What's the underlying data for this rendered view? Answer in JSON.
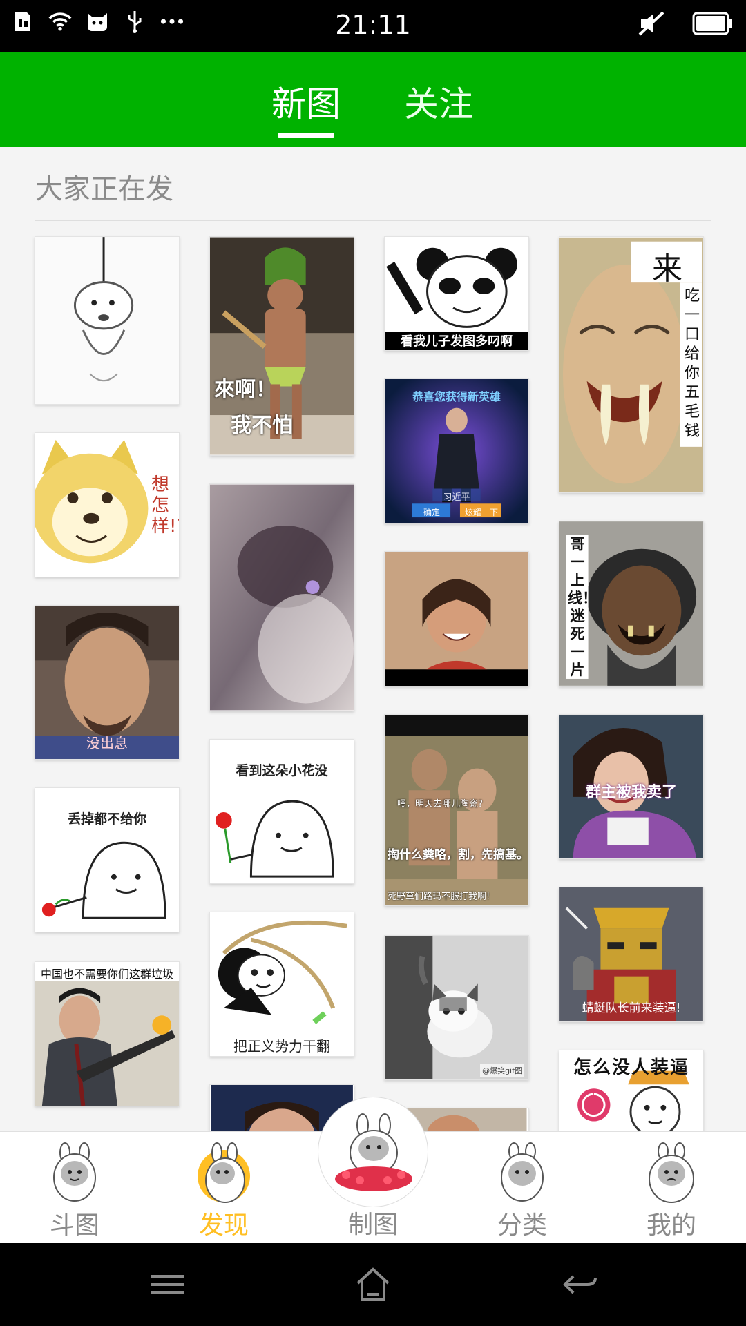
{
  "status_bar": {
    "time": "21:11",
    "icons_left": [
      "sim-card-icon",
      "wifi-icon",
      "cat-notification-icon",
      "usb-icon",
      "more-dots-icon"
    ],
    "icons_right": [
      "mute-icon",
      "battery-icon"
    ]
  },
  "top_tabs": [
    {
      "label": "新图",
      "active": true
    },
    {
      "label": "关注",
      "active": false
    }
  ],
  "section": {
    "title": "大家正在发"
  },
  "feed": {
    "captions": {
      "card2": [
        "來啊！",
        "我不怕"
      ],
      "card3": "看我儿子发图多叼啊",
      "card4_big": "来",
      "card4_side": "吃一口给你五毛钱",
      "card6_header": "恭喜您获得新英雄",
      "card6_name": "习近平",
      "card6_btn1": "确定",
      "card6_btn2": "炫耀一下",
      "card8_side": "哥一上线！迷死一片",
      "card9_tag": "没出息",
      "card12_top": "看到这朵小花没",
      "card13_lines": [
        "嘿，明天去哪儿陶瓷?",
        "掏什么粪咯，割，先搞基。",
        "死野草们路玛不服打我啊!"
      ],
      "card14": "群主被我卖了",
      "card15": "丢掉都不给你",
      "card16": "把正义势力干翻",
      "card18": "蜻蜓队长前来装逼!",
      "card19": "中国也不需要你们这群垃圾",
      "card20": "怎么没人装逼",
      "card17_watermark": "@爆笑gif图",
      "card5_vert": "想怎样!?"
    },
    "colors": {
      "card_border": "#e3e3e3",
      "accent_green": "#00b200",
      "accent_yellow": "#ffbf24"
    }
  },
  "bottom_nav": {
    "items": [
      {
        "label": "斗图",
        "active": false,
        "icon": "bunny-face-icon"
      },
      {
        "label": "发现",
        "active": true,
        "icon": "bunny-discover-icon"
      },
      {
        "label": "制图",
        "active": false,
        "icon": "bunny-create-icon"
      },
      {
        "label": "分类",
        "active": false,
        "icon": "bunny-category-icon"
      },
      {
        "label": "我的",
        "active": false,
        "icon": "bunny-profile-icon"
      }
    ]
  },
  "system_nav": {
    "icons": [
      "menu-icon",
      "home-icon",
      "back-icon"
    ]
  }
}
